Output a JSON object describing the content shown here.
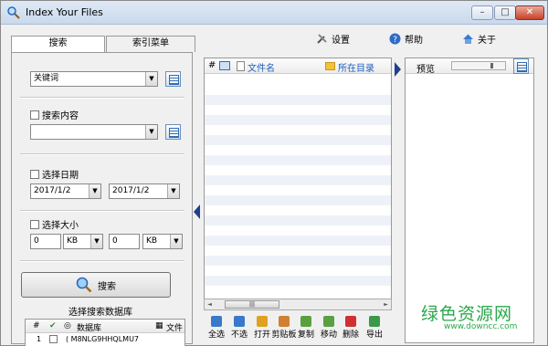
{
  "window": {
    "title": "Index Your Files"
  },
  "tabs": [
    {
      "label": "搜索"
    },
    {
      "label": "索引菜单"
    }
  ],
  "top_menu": [
    {
      "label": "设置",
      "icon": "tools-icon"
    },
    {
      "label": "帮助",
      "icon": "help-icon"
    },
    {
      "label": "关于",
      "icon": "home-icon"
    }
  ],
  "search": {
    "keyword_value": "关键词",
    "content_checkbox_label": "搜索内容",
    "content_value": "",
    "date_checkbox_label": "选择日期",
    "date_from": "2017/1/2",
    "date_to": "2017/1/2",
    "size_checkbox_label": "选择大小",
    "size_min_value": "0",
    "size_min_unit": "KB",
    "size_max_value": "0",
    "size_max_unit": "KB",
    "search_button": "搜索",
    "db_title": "选择搜索数据库"
  },
  "db_table": {
    "headers": {
      "num": "#",
      "name": "数据库",
      "files": "文件"
    },
    "rows": [
      {
        "num": "1",
        "name": "( M8NLG9HHQLMU7"
      }
    ]
  },
  "results": {
    "headers": {
      "num": "#",
      "filename": "文件名",
      "dir": "所在目录"
    }
  },
  "toolbar": [
    {
      "label": "全选",
      "color": "#3a78c9"
    },
    {
      "label": "不选",
      "color": "#3a78c9"
    },
    {
      "label": "打开",
      "color": "#e0a020"
    },
    {
      "label": "剪贴板",
      "color": "#d08030"
    },
    {
      "label": "复制",
      "color": "#5aa040"
    },
    {
      "label": "移动",
      "color": "#5aa040"
    },
    {
      "label": "删除",
      "color": "#d03030"
    },
    {
      "label": "导出",
      "color": "#3a9a4a"
    }
  ],
  "preview": {
    "label": "预览",
    "zoom_fraction": 0.75
  },
  "watermark": {
    "text": "绿色资源网",
    "url": "www.downcc.com"
  },
  "colors": {
    "accent": "#1d5fbf",
    "watermark": "#2aa84a"
  }
}
